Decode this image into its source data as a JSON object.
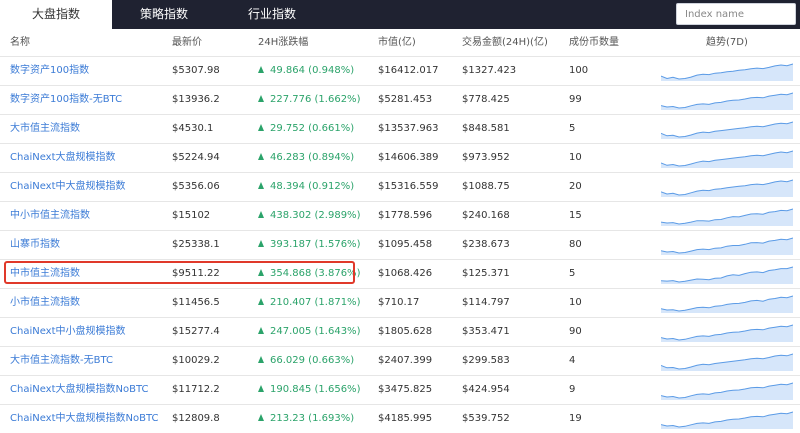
{
  "tabs": [
    {
      "label": "大盘指数",
      "active": true
    },
    {
      "label": "策略指数",
      "active": false
    },
    {
      "label": "行业指数",
      "active": false
    }
  ],
  "search": {
    "placeholder": "Index name",
    "value": ""
  },
  "columns": [
    "名称",
    "最新价",
    "24H涨跌幅",
    "市值(亿)",
    "交易金额(24H)(亿)",
    "成份币数量",
    "趋势(7D)"
  ],
  "accent_colors": {
    "topbar": "#1f2231",
    "link": "#3b7bd6",
    "up": "#2ba36a",
    "highlight": "#e0392a",
    "sparkline": "#5b9be6"
  },
  "rows": [
    {
      "name": "数字资产100指数",
      "price": "$5307.98",
      "change": "49.864 (0.948%)",
      "mcap": "$16412.017",
      "volume": "$1327.423",
      "count": "100",
      "trend": [
        3,
        2,
        2.5,
        1.8,
        2,
        2.6,
        3.4,
        3.8,
        3.6,
        4.2,
        4.4,
        4.8,
        5,
        5.4,
        5.6,
        6,
        6.3,
        6.1,
        6.6,
        7.2,
        7.6,
        7.3,
        8
      ]
    },
    {
      "name": "数字资产100指数-无BTC",
      "price": "$13936.2",
      "change": "227.776 (1.662%)",
      "mcap": "$5281.453",
      "volume": "$778.425",
      "count": "99",
      "trend": [
        3,
        2.4,
        2.6,
        2,
        2.2,
        2.9,
        3.5,
        3.7,
        3.5,
        4.1,
        4.3,
        4.9,
        5.2,
        5.3,
        5.7,
        6.2,
        6.4,
        6.2,
        6.9,
        7.3,
        7.7,
        7.5,
        8.2
      ]
    },
    {
      "name": "大市值主流指数",
      "price": "$4530.1",
      "change": "29.752 (0.661%)",
      "mcap": "$13537.963",
      "volume": "$848.581",
      "count": "5",
      "trend": [
        3.2,
        2.2,
        2.4,
        1.7,
        1.9,
        2.5,
        3.3,
        3.7,
        3.5,
        4,
        4.3,
        4.6,
        4.9,
        5.2,
        5.5,
        5.9,
        6.1,
        5.9,
        6.4,
        7,
        7.3,
        7.1,
        7.8
      ]
    },
    {
      "name": "ChaiNext大盘规模指数",
      "price": "$5224.94",
      "change": "46.283 (0.894%)",
      "mcap": "$14606.389",
      "volume": "$973.952",
      "count": "10",
      "trend": [
        3,
        2.1,
        2.4,
        1.8,
        2,
        2.6,
        3.3,
        3.8,
        3.6,
        4.1,
        4.4,
        4.7,
        5,
        5.3,
        5.6,
        6,
        6.2,
        6,
        6.5,
        7.1,
        7.5,
        7.2,
        7.9
      ]
    },
    {
      "name": "ChaiNext中大盘规模指数",
      "price": "$5356.06",
      "change": "48.394 (0.912%)",
      "mcap": "$15316.559",
      "volume": "$1088.75",
      "count": "20",
      "trend": [
        3.1,
        2.2,
        2.5,
        1.8,
        2,
        2.7,
        3.4,
        3.8,
        3.6,
        4.2,
        4.4,
        4.8,
        5.1,
        5.4,
        5.6,
        6.1,
        6.3,
        6.1,
        6.6,
        7.2,
        7.6,
        7.3,
        8
      ]
    },
    {
      "name": "中小市值主流指数",
      "price": "$15102",
      "change": "438.302 (2.989%)",
      "mcap": "$1778.596",
      "volume": "$240.168",
      "count": "15",
      "trend": [
        3,
        2.6,
        2.8,
        2.2,
        2.5,
        3,
        3.6,
        3.6,
        3.4,
        4,
        4.1,
        4.8,
        5.3,
        5.2,
        5.8,
        6.4,
        6.5,
        6.3,
        7.1,
        7.4,
        7.9,
        7.8,
        8.5
      ]
    },
    {
      "name": "山寨币指数",
      "price": "$25338.1",
      "change": "393.187 (1.576%)",
      "mcap": "$1095.458",
      "volume": "$238.673",
      "count": "80",
      "trend": [
        3,
        2.5,
        2.7,
        2.1,
        2.3,
        2.9,
        3.5,
        3.7,
        3.5,
        4.1,
        4.2,
        4.9,
        5.2,
        5.2,
        5.7,
        6.3,
        6.4,
        6.2,
        7,
        7.3,
        7.8,
        7.6,
        8.3
      ]
    },
    {
      "name": "中市值主流指数",
      "price": "$9511.22",
      "change": "354.868 (3.876%)",
      "mcap": "$1068.426",
      "volume": "$125.371",
      "count": "5",
      "trend": [
        2.8,
        2.7,
        2.9,
        2.3,
        2.6,
        3.1,
        3.6,
        3.5,
        3.3,
        3.9,
        4,
        4.9,
        5.4,
        5.1,
        5.9,
        6.5,
        6.6,
        6.3,
        7.2,
        7.5,
        8,
        8,
        8.7
      ]
    },
    {
      "name": "小市值主流指数",
      "price": "$11456.5",
      "change": "210.407 (1.871%)",
      "mcap": "$710.17",
      "volume": "$114.797",
      "count": "10",
      "trend": [
        3,
        2.5,
        2.6,
        2.1,
        2.4,
        2.9,
        3.5,
        3.6,
        3.4,
        4,
        4.2,
        4.8,
        5.1,
        5.2,
        5.6,
        6.2,
        6.4,
        6.1,
        6.9,
        7.2,
        7.7,
        7.5,
        8.2
      ]
    },
    {
      "name": "ChaiNext中小盘规模指数",
      "price": "$15277.4",
      "change": "247.005 (1.643%)",
      "mcap": "$1805.628",
      "volume": "$353.471",
      "count": "90",
      "trend": [
        3,
        2.4,
        2.6,
        2,
        2.3,
        2.9,
        3.5,
        3.7,
        3.5,
        4.1,
        4.3,
        4.9,
        5.2,
        5.3,
        5.7,
        6.2,
        6.4,
        6.2,
        6.9,
        7.3,
        7.7,
        7.5,
        8.2
      ]
    },
    {
      "name": "大市值主流指数-无BTC",
      "price": "$10029.2",
      "change": "66.029 (0.663%)",
      "mcap": "$2407.399",
      "volume": "$299.583",
      "count": "4",
      "trend": [
        3.2,
        2.3,
        2.4,
        1.8,
        2,
        2.6,
        3.3,
        3.7,
        3.5,
        4,
        4.3,
        4.6,
        4.9,
        5.2,
        5.5,
        5.9,
        6.1,
        5.9,
        6.4,
        7,
        7.3,
        7.1,
        7.8
      ]
    },
    {
      "name": "ChaiNext大盘规模指数NoBTC",
      "price": "$11712.2",
      "change": "190.845 (1.656%)",
      "mcap": "$3475.825",
      "volume": "$424.954",
      "count": "9",
      "trend": [
        3,
        2.4,
        2.6,
        2,
        2.2,
        2.9,
        3.5,
        3.7,
        3.5,
        4.1,
        4.3,
        4.9,
        5.2,
        5.3,
        5.7,
        6.2,
        6.4,
        6.2,
        6.9,
        7.3,
        7.7,
        7.5,
        8.2
      ]
    },
    {
      "name": "ChaiNext中大盘规模指数NoBTC",
      "price": "$12809.8",
      "change": "213.23 (1.693%)",
      "mcap": "$4185.995",
      "volume": "$539.752",
      "count": "19",
      "trend": [
        3,
        2.4,
        2.6,
        2,
        2.3,
        2.9,
        3.5,
        3.7,
        3.5,
        4.1,
        4.3,
        4.9,
        5.2,
        5.3,
        5.7,
        6.2,
        6.4,
        6.2,
        6.9,
        7.3,
        7.7,
        7.5,
        8.2
      ]
    }
  ],
  "highlighted_row": 7
}
